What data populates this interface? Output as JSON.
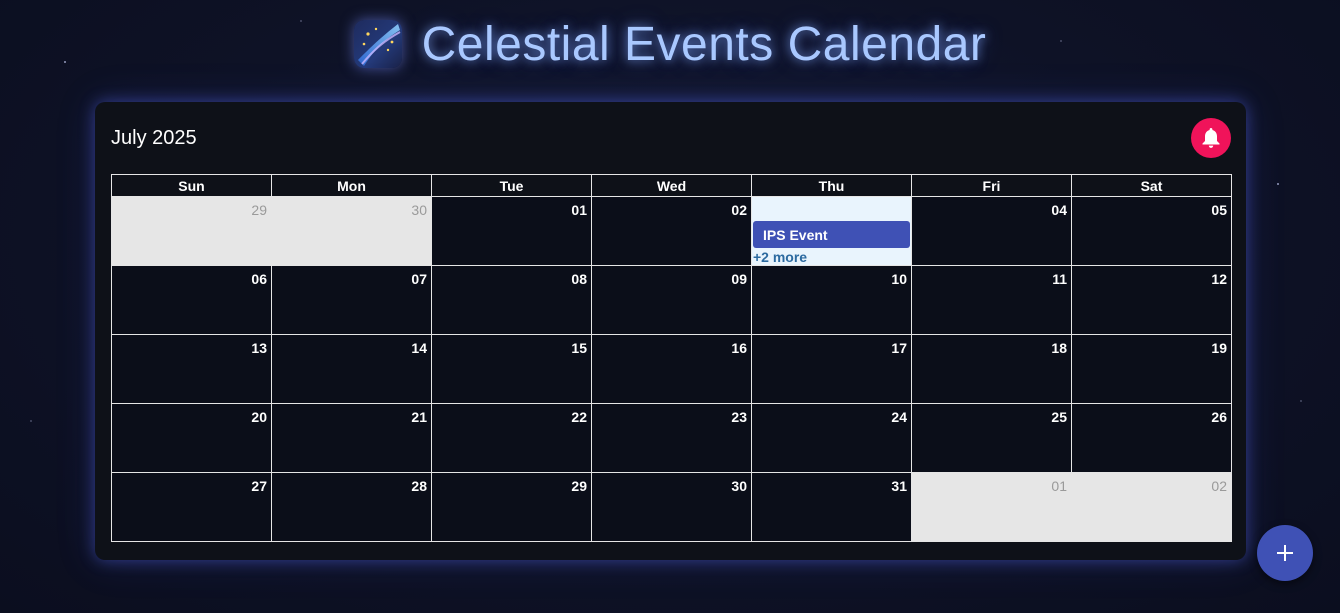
{
  "header": {
    "title": "Celestial Events Calendar",
    "logo_icon": "shooting-star-icon"
  },
  "calendar": {
    "month_label": "July 2025",
    "notification_icon": "bell-icon",
    "accent_color": "#f0135a",
    "weekdays": [
      "Sun",
      "Mon",
      "Tue",
      "Wed",
      "Thu",
      "Fri",
      "Sat"
    ],
    "weeks": [
      [
        {
          "day": "29",
          "other": true
        },
        {
          "day": "30",
          "other": true
        },
        {
          "day": "01"
        },
        {
          "day": "02"
        },
        {
          "day": "",
          "today": true,
          "event": "IPS Event",
          "more": "+2 more"
        },
        {
          "day": "04"
        },
        {
          "day": "05"
        }
      ],
      [
        {
          "day": "06"
        },
        {
          "day": "07"
        },
        {
          "day": "08"
        },
        {
          "day": "09"
        },
        {
          "day": "10"
        },
        {
          "day": "11"
        },
        {
          "day": "12"
        }
      ],
      [
        {
          "day": "13"
        },
        {
          "day": "14"
        },
        {
          "day": "15"
        },
        {
          "day": "16"
        },
        {
          "day": "17"
        },
        {
          "day": "18"
        },
        {
          "day": "19"
        }
      ],
      [
        {
          "day": "20"
        },
        {
          "day": "21"
        },
        {
          "day": "22"
        },
        {
          "day": "23"
        },
        {
          "day": "24"
        },
        {
          "day": "25"
        },
        {
          "day": "26"
        }
      ],
      [
        {
          "day": "27"
        },
        {
          "day": "28"
        },
        {
          "day": "29"
        },
        {
          "day": "30"
        },
        {
          "day": "31"
        },
        {
          "day": "01",
          "other": true
        },
        {
          "day": "02",
          "other": true
        }
      ]
    ]
  },
  "fab": {
    "icon": "plus-icon",
    "color": "#3f51b5"
  }
}
